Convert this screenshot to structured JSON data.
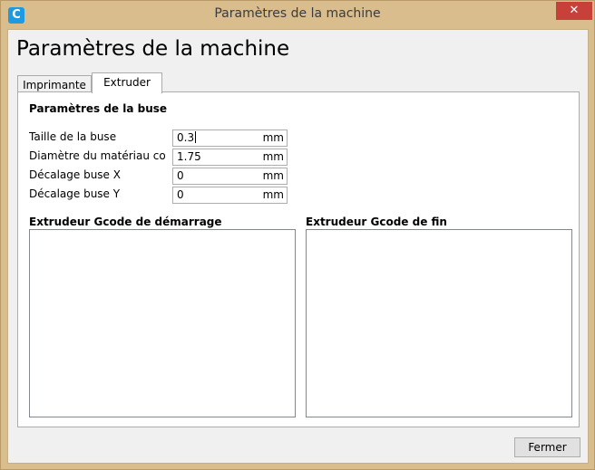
{
  "window": {
    "title": "Paramètres de la machine",
    "close_glyph": "✕",
    "app_icon": "C",
    "accent_color": "#d9bd8c",
    "close_color": "#c7403a"
  },
  "dialog": {
    "heading": "Paramètres de la machine"
  },
  "tabs": [
    {
      "label": "Imprimante",
      "selected": false
    },
    {
      "label": "Extruder",
      "selected": true
    }
  ],
  "nozzle": {
    "section_title": "Paramètres de la buse",
    "fields": [
      {
        "label": "Taille de la buse",
        "value": "0.3",
        "unit": "mm",
        "focused": true
      },
      {
        "label": "Diamètre du matériau co...",
        "value": "1.75",
        "unit": "mm"
      },
      {
        "label": "Décalage buse X",
        "value": "0",
        "unit": "mm"
      },
      {
        "label": "Décalage buse Y",
        "value": "0",
        "unit": "mm"
      }
    ]
  },
  "gcode": {
    "start_label": "Extrudeur Gcode de démarrage",
    "start_value": "",
    "end_label": "Extrudeur Gcode de fin",
    "end_value": ""
  },
  "footer": {
    "close_label": "Fermer"
  }
}
